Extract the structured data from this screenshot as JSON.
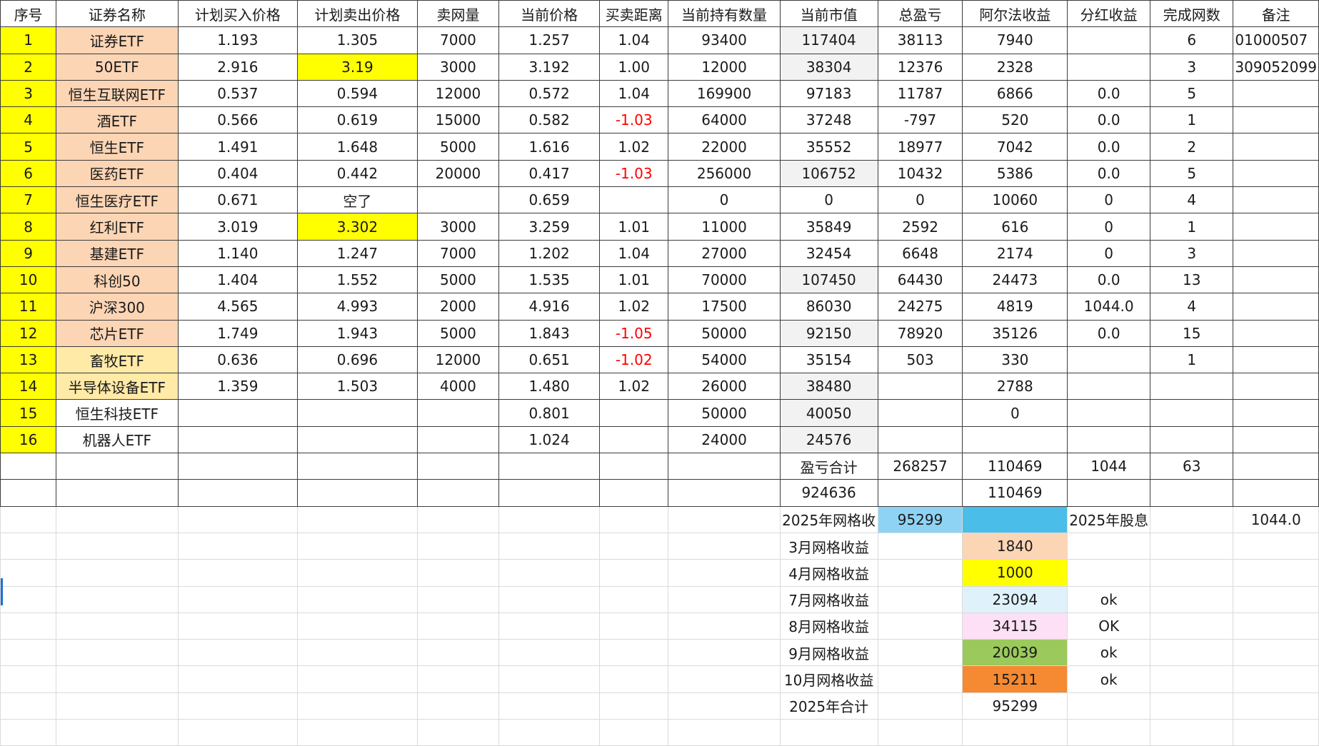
{
  "columns": [
    "序号",
    "证券名称",
    "计划买入价格",
    "计划卖出价格",
    "卖网量",
    "当前价格",
    "买卖距离",
    "当前持有数量",
    "当前市值",
    "总盈亏",
    "阿尔法收益",
    "分红收益",
    "完成网数",
    "备注"
  ],
  "rows": [
    [
      "1",
      "证券ETF",
      "1.193",
      "1.305",
      "7000",
      "1.257",
      "1.04",
      "93400",
      "117404",
      "38113",
      "7940",
      "",
      "6",
      "01000507"
    ],
    [
      "2",
      "50ETF",
      "2.916",
      "3.19",
      "3000",
      "3.192",
      "1.00",
      "12000",
      "38304",
      "12376",
      "2328",
      "",
      "3",
      "309052099"
    ],
    [
      "3",
      "恒生互联网ETF",
      "0.537",
      "0.594",
      "12000",
      "0.572",
      "1.04",
      "169900",
      "97183",
      "11787",
      "6866",
      "0.0",
      "5",
      ""
    ],
    [
      "4",
      "酒ETF",
      "0.566",
      "0.619",
      "15000",
      "0.582",
      "-1.03",
      "64000",
      "37248",
      "-797",
      "520",
      "0.0",
      "1",
      ""
    ],
    [
      "5",
      "恒生ETF",
      "1.491",
      "1.648",
      "5000",
      "1.616",
      "1.02",
      "22000",
      "35552",
      "18977",
      "7042",
      "0.0",
      "2",
      ""
    ],
    [
      "6",
      "医药ETF",
      "0.404",
      "0.442",
      "20000",
      "0.417",
      "-1.03",
      "256000",
      "106752",
      "10432",
      "5386",
      "0.0",
      "5",
      ""
    ],
    [
      "7",
      "恒生医疗ETF",
      "0.671",
      "空了",
      "",
      "0.659",
      "",
      "0",
      "0",
      "0",
      "10060",
      "0",
      "4",
      ""
    ],
    [
      "8",
      "红利ETF",
      "3.019",
      "3.302",
      "3000",
      "3.259",
      "1.01",
      "11000",
      "35849",
      "2592",
      "616",
      "0",
      "1",
      ""
    ],
    [
      "9",
      "基建ETF",
      "1.140",
      "1.247",
      "7000",
      "1.202",
      "1.04",
      "27000",
      "32454",
      "6648",
      "2174",
      "0",
      "3",
      ""
    ],
    [
      "10",
      "科创50",
      "1.404",
      "1.552",
      "5000",
      "1.535",
      "1.01",
      "70000",
      "107450",
      "64430",
      "24473",
      "0.0",
      "13",
      ""
    ],
    [
      "11",
      "沪深300",
      "4.565",
      "4.993",
      "2000",
      "4.916",
      "1.02",
      "17500",
      "86030",
      "24275",
      "4819",
      "1044.0",
      "4",
      ""
    ],
    [
      "12",
      "芯片ETF",
      "1.749",
      "1.943",
      "5000",
      "1.843",
      "-1.05",
      "50000",
      "92150",
      "78920",
      "35126",
      "0.0",
      "15",
      ""
    ],
    [
      "13",
      "畜牧ETF",
      "0.636",
      "0.696",
      "12000",
      "0.651",
      "-1.02",
      "54000",
      "35154",
      "503",
      "330",
      "",
      "1",
      ""
    ],
    [
      "14",
      "半导体设备ETF",
      "1.359",
      "1.503",
      "4000",
      "1.480",
      "1.02",
      "26000",
      "38480",
      "",
      "2788",
      "",
      "",
      ""
    ],
    [
      "15",
      "恒生科技ETF",
      "",
      "",
      "",
      "0.801",
      "",
      "50000",
      "40050",
      "",
      "0",
      "",
      "",
      ""
    ],
    [
      "16",
      "机器人ETF",
      "",
      "",
      "",
      "1.024",
      "",
      "24000",
      "24576",
      "",
      "",
      "",
      "",
      ""
    ],
    [
      "",
      "",
      "",
      "",
      "",
      "",
      "",
      "",
      "盈亏合计",
      "268257",
      "110469",
      "1044",
      "63",
      ""
    ],
    [
      "",
      "",
      "",
      "",
      "",
      "",
      "",
      "",
      "924636",
      "",
      "110469",
      "",
      "",
      ""
    ],
    [
      "",
      "",
      "",
      "",
      "",
      "",
      "",
      "",
      "2025年网格收",
      "95299",
      "",
      "2025年股息",
      "",
      "1044.0"
    ],
    [
      "",
      "",
      "",
      "",
      "",
      "",
      "",
      "",
      "3月网格收益",
      "",
      "1840",
      "",
      "",
      ""
    ],
    [
      "",
      "",
      "",
      "",
      "",
      "",
      "",
      "",
      "4月网格收益",
      "",
      "1000",
      "",
      "",
      ""
    ],
    [
      "",
      "",
      "",
      "",
      "",
      "",
      "",
      "",
      "7月网格收益",
      "",
      "23094",
      "ok",
      "",
      ""
    ],
    [
      "",
      "",
      "",
      "",
      "",
      "",
      "",
      "",
      "8月网格收益",
      "",
      "34115",
      "OK",
      "",
      ""
    ],
    [
      "",
      "",
      "",
      "",
      "",
      "",
      "",
      "",
      "9月网格收益",
      "",
      "20039",
      "ok",
      "",
      ""
    ],
    [
      "",
      "",
      "",
      "",
      "",
      "",
      "",
      "",
      "10月网格收益",
      "",
      "15211",
      "ok",
      "",
      ""
    ],
    [
      "",
      "",
      "",
      "",
      "",
      "",
      "",
      "",
      "2025年合计",
      "",
      "95299",
      "",
      "",
      ""
    ],
    [
      "",
      "",
      "",
      "",
      "",
      "",
      "",
      "",
      "",
      "",
      "",
      "",
      "",
      ""
    ]
  ],
  "colors": {
    "index_fill": "#ffff00",
    "name_fill": "#fcd5b5",
    "highlight_yellow": "#ffff00",
    "negative_text": "#ff0000",
    "grid_income_blue": "#8fd3f4",
    "grid_income_blue2": "#4bbde9",
    "march_fill": "#fcd5b5",
    "april_fill": "#ffff00",
    "july_fill": "#dff2fb",
    "august_fill": "#fde0f5",
    "september_fill": "#9bc95b",
    "october_fill": "#f58a33"
  }
}
